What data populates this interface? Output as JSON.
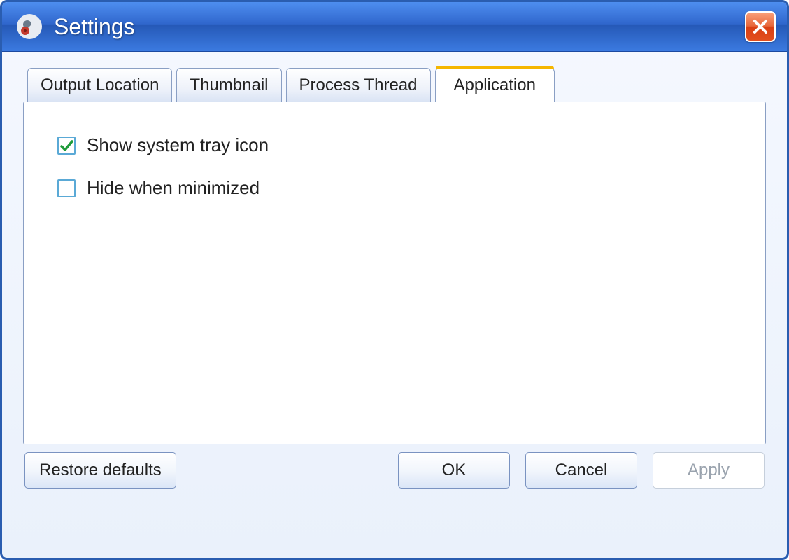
{
  "window": {
    "title": "Settings"
  },
  "tabs": [
    {
      "label": "Output Location",
      "active": false
    },
    {
      "label": "Thumbnail",
      "active": false
    },
    {
      "label": "Process Thread",
      "active": false
    },
    {
      "label": "Application",
      "active": true
    }
  ],
  "panel": {
    "options": [
      {
        "label": "Show system tray icon",
        "checked": true
      },
      {
        "label": "Hide when minimized",
        "checked": false
      }
    ]
  },
  "buttons": {
    "restore_defaults": "Restore defaults",
    "ok": "OK",
    "cancel": "Cancel",
    "apply": "Apply",
    "apply_enabled": false
  }
}
